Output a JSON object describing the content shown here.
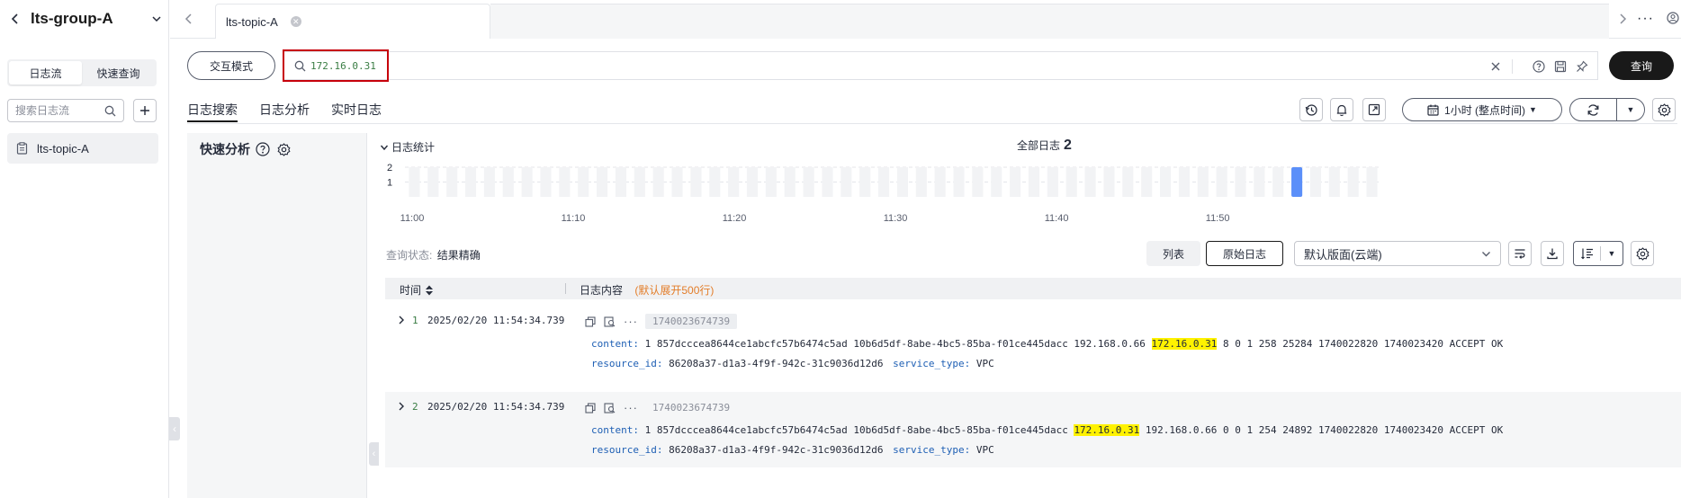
{
  "sidebar": {
    "title": "lts-group-A",
    "tabs": [
      "日志流",
      "快速查询"
    ],
    "search_placeholder": "搜索日志流",
    "stream_item": "lts-topic-A"
  },
  "tabbar": {
    "active_tab": "lts-topic-A"
  },
  "query": {
    "mode_button": "交互模式",
    "text": "172.16.0.31",
    "search_button": "查询"
  },
  "subtabs": [
    "日志搜索",
    "日志分析",
    "实时日志"
  ],
  "toolbar": {
    "time_range": "1小时 (整点时间)"
  },
  "quick_analysis": {
    "title": "快速分析"
  },
  "histogram": {
    "toggle_label": "日志统计",
    "total_label": "全部日志",
    "total_count": "2"
  },
  "chart_data": {
    "type": "bar",
    "x_tick_labels": [
      "11:00",
      "11:10",
      "11:20",
      "11:30",
      "11:40",
      "11:50"
    ],
    "y_tick_labels": [
      "2",
      "1"
    ],
    "ylim": [
      0,
      2
    ],
    "bar_count": 52,
    "highlight_bar_index": 47,
    "highlight_value": 2,
    "highlight_color": "#5b8ff9",
    "empty_bar_color": "#f2f3f5",
    "grid": true
  },
  "results": {
    "status_label": "查询状态:",
    "status_value": "结果精确",
    "view_list": "列表",
    "view_raw": "原始日志",
    "layout": "默认版面(云端)"
  },
  "table": {
    "col_time": "时间",
    "col_content": "日志内容",
    "col_hint": "(默认展开500行)",
    "rows": [
      {
        "index": "1",
        "time": "2025/02/20 11:54:34.739",
        "tag": "1740023674739",
        "content_key": "content:",
        "content_pre": "1 857dcccea8644ce1abcfc57b6474c5ad 10b6d5df-8abe-4bc5-85ba-f01ce445dacc 192.168.0.66",
        "content_hl": "172.16.0.31",
        "content_post": "8 0 1 258 25284 1740022820 1740023420 ACCEPT OK",
        "rid_key": "resource_id:",
        "rid_val": "86208a37-d1a3-4f9f-942c-31c9036d12d6",
        "stype_key": "service_type:",
        "stype_val": "VPC"
      },
      {
        "index": "2",
        "time": "2025/02/20 11:54:34.739",
        "tag": "1740023674739",
        "content_key": "content:",
        "content_pre": "1 857dcccea8644ce1abcfc57b6474c5ad 10b6d5df-8abe-4bc5-85ba-f01ce445dacc",
        "content_hl": "172.16.0.31",
        "content_post": "192.168.0.66 0 0 1 254 24892 1740022820 1740023420 ACCEPT OK",
        "rid_key": "resource_id:",
        "rid_val": "86208a37-d1a3-4f9f-942c-31c9036d12d6",
        "stype_key": "service_type:",
        "stype_val": "VPC"
      }
    ]
  },
  "colors": {
    "accent_dark": "#191919",
    "highlight_border": "#c7000b",
    "keyword_highlight": "#fff200",
    "hint_orange": "#e37d29",
    "index_green": "#3a7d44",
    "key_blue": "#1e5fb4"
  }
}
